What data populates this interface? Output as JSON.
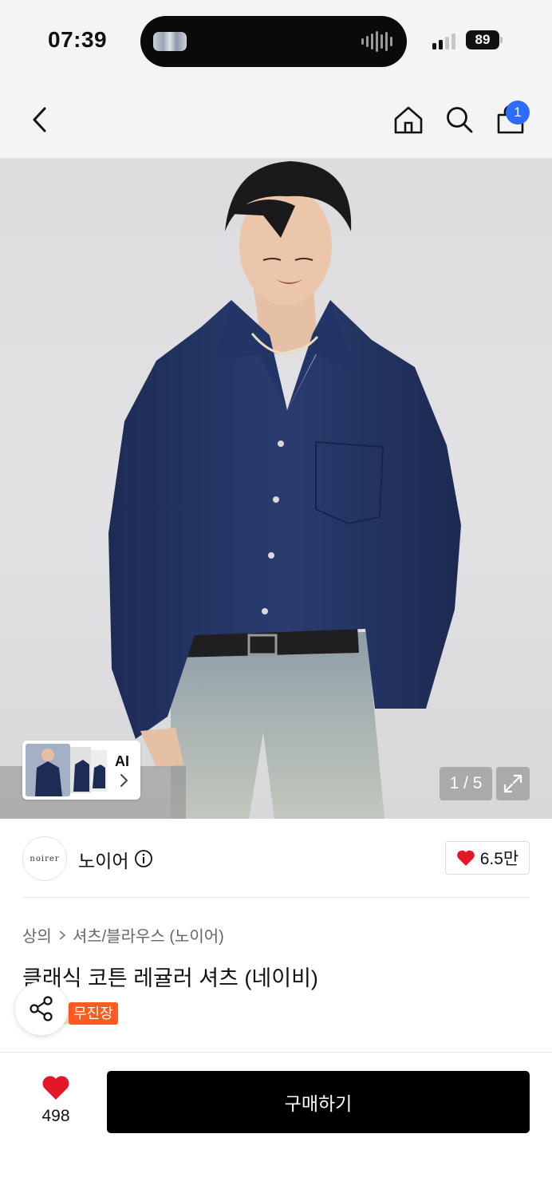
{
  "status_bar": {
    "time": "07:39",
    "battery": "89"
  },
  "top_nav": {
    "back_icon": "chevron-left-icon",
    "home_icon": "home-icon",
    "search_icon": "search-icon",
    "cart_icon": "shopping-bag-icon",
    "cart_badge": "1",
    "badge_color": "#2d6cf6"
  },
  "hero": {
    "counter": "1 / 5",
    "ai_label": "AI",
    "expand_icon": "expand-icon"
  },
  "brand": {
    "logo_text": "noirer",
    "name": "노이어",
    "info_icon": "info-icon",
    "likes": "6.5만",
    "heart_color": "#e4162a"
  },
  "product": {
    "breadcrumb": [
      "상의",
      "셔츠/블라우스 (노이어)"
    ],
    "title": "클래식 코튼 레귤러 셔츠 (네이비)",
    "badge_free": "무진장",
    "badge_color": "#ff5a1f",
    "share_icon": "share-icon"
  },
  "bottom_bar": {
    "wish_count": "498",
    "buy_label": "구매하기"
  }
}
